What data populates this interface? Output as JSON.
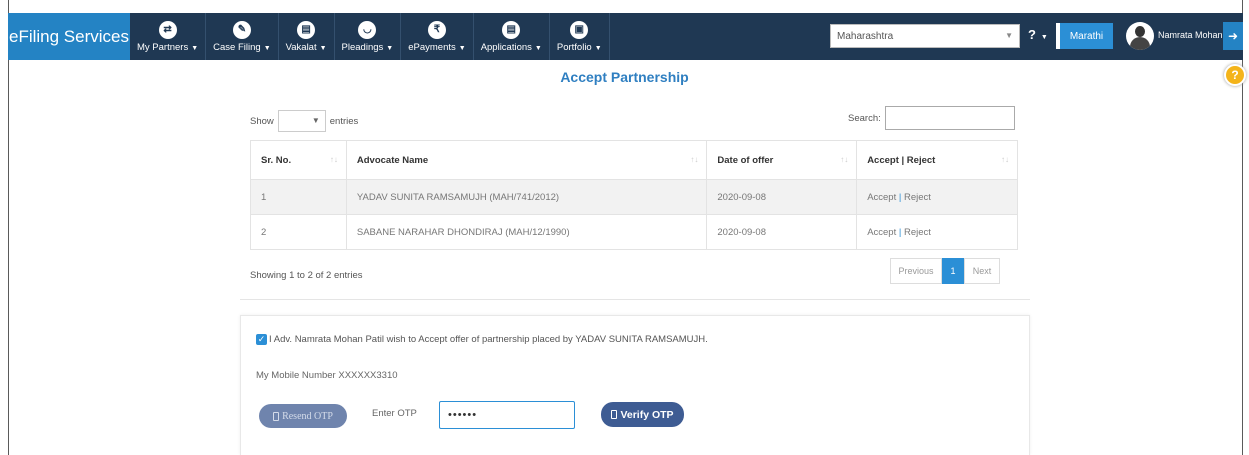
{
  "navbar": {
    "brand": "eFiling Services",
    "menu": [
      {
        "label": "My Partners",
        "icon": "partners-icon",
        "glyph": "⇄"
      },
      {
        "label": "Case Filing",
        "icon": "pencil-icon",
        "glyph": "✎"
      },
      {
        "label": "Vakalat",
        "icon": "document-icon",
        "glyph": "▤"
      },
      {
        "label": "Pleadings",
        "icon": "hands-icon",
        "glyph": "◡"
      },
      {
        "label": "ePayments",
        "icon": "rupee-icon",
        "glyph": "₹"
      },
      {
        "label": "Applications",
        "icon": "document-icon",
        "glyph": "▤"
      },
      {
        "label": "Portfolio",
        "icon": "briefcase-icon",
        "glyph": "▣"
      }
    ],
    "state_select": "Maharashtra",
    "help": "?",
    "language_button": "Marathi",
    "user_name": "Namrata Mohan...",
    "logout_icon": "logout-icon"
  },
  "page": {
    "title": "Accept Partnership"
  },
  "table": {
    "show_label": "Show",
    "entries_label": "entries",
    "search_label": "Search:",
    "columns": [
      "Sr. No.",
      "Advocate Name",
      "Date of offer",
      "Accept | Reject"
    ],
    "rows": [
      {
        "sr": "1",
        "name": "YADAV SUNITA RAMSAMUJH (MAH/741/2012)",
        "date": "2020-09-08",
        "accept": "Accept",
        "sep": "|",
        "reject": "Reject"
      },
      {
        "sr": "2",
        "name": "SABANE NARAHAR DHONDIRAJ (MAH/12/1990)",
        "date": "2020-09-08",
        "accept": "Accept",
        "sep": "|",
        "reject": "Reject"
      }
    ],
    "info": "Showing 1 to 2 of 2 entries",
    "pagination": {
      "previous": "Previous",
      "page": "1",
      "next": "Next"
    }
  },
  "consent": {
    "statement": "I Adv. Namrata Mohan Patil wish to Accept offer of partnership placed by YADAV SUNITA RAMSAMUJH.",
    "mobile": "My Mobile Number XXXXXX3310",
    "resend_otp": "Resend OTP",
    "otp_label": "Enter OTP",
    "otp_value": "••••••",
    "verify_otp": "Verify OTP"
  },
  "colors": {
    "navbar": "#1f3853",
    "brand": "#2483c4",
    "accent": "#2b8fd6",
    "title": "#2f7fc1",
    "help_badge": "#f4b41a"
  }
}
